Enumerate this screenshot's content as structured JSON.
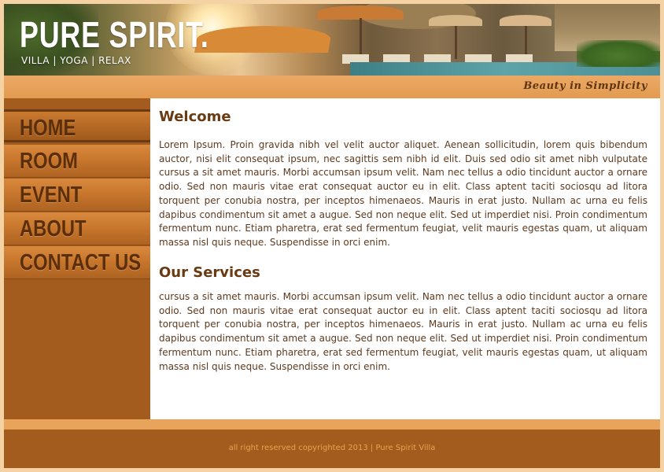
{
  "header": {
    "site_title": "PURE SPIRIT.",
    "tagline": "VILLA  |  YOGA  |  RELAX",
    "slogan": "Beauty in Simplicity"
  },
  "nav": {
    "items": [
      {
        "label": "HOME",
        "active": true
      },
      {
        "label": "ROOM",
        "active": false
      },
      {
        "label": "EVENT",
        "active": false
      },
      {
        "label": "ABOUT",
        "active": false
      },
      {
        "label": "CONTACT US",
        "active": false
      }
    ]
  },
  "content": {
    "welcome_heading": "Welcome",
    "welcome_text": "Lorem Ipsum. Proin gravida nibh vel velit auctor aliquet. Aenean sollicitudin, lorem quis bibendum auctor, nisi elit consequat ipsum, nec sagittis sem nibh id elit. Duis sed odio sit amet nibh vulputate cursus a sit amet mauris. Morbi accumsan ipsum velit. Nam nec tellus a odio tincidunt auctor a ornare odio. Sed non mauris vitae erat consequat auctor eu in elit. Class aptent taciti sociosqu ad litora torquent per conubia nostra, per inceptos himenaeos. Mauris in erat justo. Nullam ac urna eu felis dapibus condimentum sit amet a augue. Sed non neque elit. Sed ut imperdiet nisi. Proin condimentum fermentum nunc. Etiam pharetra, erat sed fermentum feugiat, velit mauris egestas quam, ut aliquam massa nisl quis neque. Suspendisse in orci enim.",
    "services_heading": "Our Services",
    "services_text": "cursus a sit amet mauris. Morbi accumsan ipsum velit. Nam nec tellus a odio tincidunt auctor a ornare odio. Sed non mauris vitae erat consequat auctor eu in elit. Class aptent taciti sociosqu ad litora torquent per conubia nostra, per inceptos himenaeos. Mauris in erat justo. Nullam ac urna eu felis dapibus condimentum sit amet a augue. Sed non neque elit. Sed ut imperdiet nisi. Proin condimentum fermentum nunc. Etiam pharetra, erat sed fermentum feugiat, velit mauris egestas quam, ut aliquam massa nisl quis neque. Suspendisse in orci enim."
  },
  "footer": {
    "text": "all right reserved copyrighted 2013  |  Pure Spirit Villa"
  },
  "colors": {
    "accent": "#e8a45a",
    "sidebar": "#a35b1e",
    "heading": "#6a3a12",
    "body_text": "#5e3a1e",
    "footer_text": "#e9a252"
  }
}
